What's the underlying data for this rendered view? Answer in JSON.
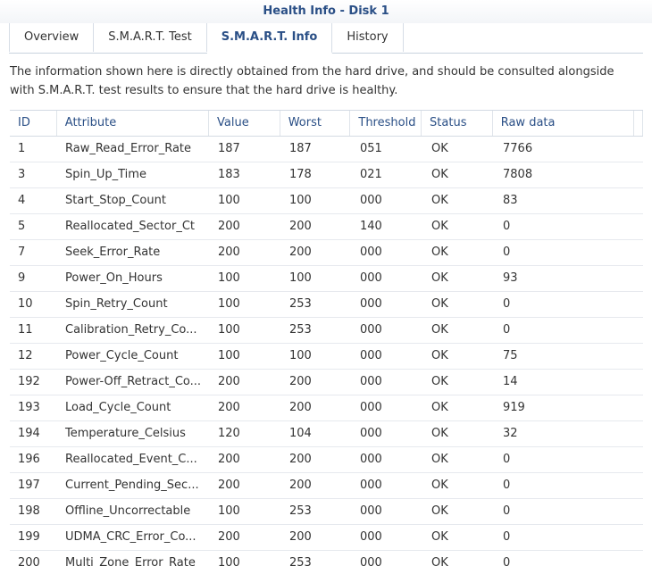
{
  "window": {
    "title": "Health Info - Disk 1"
  },
  "tabs": [
    {
      "label": "Overview",
      "active": false
    },
    {
      "label": "S.M.A.R.T. Test",
      "active": false
    },
    {
      "label": "S.M.A.R.T. Info",
      "active": true
    },
    {
      "label": "History",
      "active": false
    }
  ],
  "description": "The information shown here is directly obtained from the hard drive, and should be consulted alongside with S.M.A.R.T. test results to ensure that the hard drive is healthy.",
  "table": {
    "headers": [
      "ID",
      "Attribute",
      "Value",
      "Worst",
      "Threshold",
      "Status",
      "Raw data"
    ],
    "rows": [
      [
        "1",
        "Raw_Read_Error_Rate",
        "187",
        "187",
        "051",
        "OK",
        "7766"
      ],
      [
        "3",
        "Spin_Up_Time",
        "183",
        "178",
        "021",
        "OK",
        "7808"
      ],
      [
        "4",
        "Start_Stop_Count",
        "100",
        "100",
        "000",
        "OK",
        "83"
      ],
      [
        "5",
        "Reallocated_Sector_Ct",
        "200",
        "200",
        "140",
        "OK",
        "0"
      ],
      [
        "7",
        "Seek_Error_Rate",
        "200",
        "200",
        "000",
        "OK",
        "0"
      ],
      [
        "9",
        "Power_On_Hours",
        "100",
        "100",
        "000",
        "OK",
        "93"
      ],
      [
        "10",
        "Spin_Retry_Count",
        "100",
        "253",
        "000",
        "OK",
        "0"
      ],
      [
        "11",
        "Calibration_Retry_Co...",
        "100",
        "253",
        "000",
        "OK",
        "0"
      ],
      [
        "12",
        "Power_Cycle_Count",
        "100",
        "100",
        "000",
        "OK",
        "75"
      ],
      [
        "192",
        "Power-Off_Retract_Co...",
        "200",
        "200",
        "000",
        "OK",
        "14"
      ],
      [
        "193",
        "Load_Cycle_Count",
        "200",
        "200",
        "000",
        "OK",
        "919"
      ],
      [
        "194",
        "Temperature_Celsius",
        "120",
        "104",
        "000",
        "OK",
        "32"
      ],
      [
        "196",
        "Reallocated_Event_C...",
        "200",
        "200",
        "000",
        "OK",
        "0"
      ],
      [
        "197",
        "Current_Pending_Sec...",
        "200",
        "200",
        "000",
        "OK",
        "0"
      ],
      [
        "198",
        "Offline_Uncorrectable",
        "100",
        "253",
        "000",
        "OK",
        "0"
      ],
      [
        "199",
        "UDMA_CRC_Error_Co...",
        "200",
        "200",
        "000",
        "OK",
        "0"
      ],
      [
        "200",
        "Multi_Zone_Error_Rate",
        "100",
        "253",
        "000",
        "OK",
        "0"
      ]
    ]
  }
}
